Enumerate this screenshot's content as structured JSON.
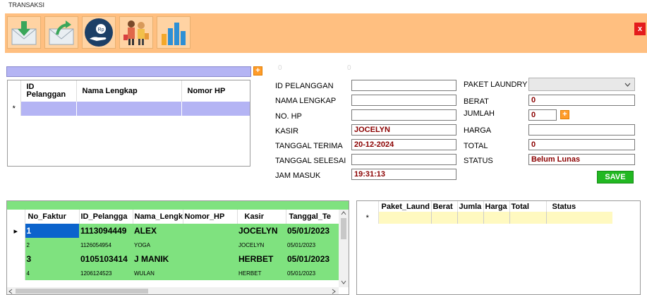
{
  "window": {
    "title": "TRANSAKSI"
  },
  "toolbar": {
    "buttons": [
      {
        "icon": "mail-inbox-icon"
      },
      {
        "icon": "mail-send-icon"
      },
      {
        "icon": "payment-hand-icon"
      },
      {
        "icon": "shopping-people-icon"
      },
      {
        "icon": "bar-chart-icon"
      }
    ],
    "close_label": "x"
  },
  "customer_search": {
    "value": "",
    "add_label": "+"
  },
  "customer_grid": {
    "columns": [
      "ID\nPelanggan",
      "Nama Lengkap",
      "Nomor HP"
    ],
    "new_row_marker": "*"
  },
  "ghost_labels": [
    "0",
    "0"
  ],
  "form": {
    "id_pelanggan": {
      "label": "ID PELANGGAN",
      "value": ""
    },
    "nama_lengkap": {
      "label": "NAMA LENGKAP",
      "value": ""
    },
    "no_hp": {
      "label": "NO. HP",
      "value": ""
    },
    "kasir": {
      "label": "KASIR",
      "value": "JOCELYN"
    },
    "tanggal_terima": {
      "label": "TANGGAL TERIMA",
      "value": "20-12-2024"
    },
    "tanggal_selesai": {
      "label": "TANGGAL SELESAI",
      "value": ""
    },
    "jam_masuk": {
      "label": "JAM MASUK",
      "value": "19:31:13"
    },
    "paket_laundry": {
      "label": "PAKET LAUNDRY",
      "value": ""
    },
    "berat": {
      "label": "BERAT",
      "value": "0"
    },
    "jumlah": {
      "label": "JUMLAH",
      "value": "0",
      "add_label": "+"
    },
    "harga": {
      "label": "HARGA",
      "value": ""
    },
    "total": {
      "label": "TOTAL",
      "value": "0"
    },
    "status": {
      "label": "STATUS",
      "value": "Belum Lunas"
    },
    "save_label": "SAVE"
  },
  "transactions": {
    "columns": [
      "No_Faktur",
      "ID_Pelanggan",
      "Nama_Lengkap",
      "Nomor_HP",
      "Kasir",
      "Tanggal_Te"
    ],
    "header_labels": [
      "No_Faktur",
      "ID_Pelangga",
      "Nama_Lengk",
      "Nomor_HP",
      "Kasir",
      "Tanggal_Te"
    ],
    "rows": [
      [
        "1",
        "1113094449",
        "ALEX",
        "",
        "JOCELYN",
        "05/01/2023"
      ],
      [
        "2",
        "1126054954",
        "YOGA",
        "",
        "JOCELYN",
        "05/01/2023"
      ],
      [
        "3",
        "0105103414",
        "J MANIK",
        "",
        "HERBET",
        "05/01/2023"
      ],
      [
        "4",
        "1206124523",
        "WULAN",
        "",
        "HERBET",
        "05/01/2023"
      ]
    ],
    "selected_marker": "▸"
  },
  "detail_grid": {
    "columns": [
      "Paket_Laund",
      "Berat",
      "Jumla",
      "Harga",
      "Total",
      "Status"
    ],
    "new_row_marker": "*"
  },
  "colors": {
    "toolbar_bg": "#ffbf80",
    "close_red": "#e41c1c",
    "search_blue": "#b4b4f4",
    "grid_green": "#7fe27f",
    "detail_yellow": "#fff9c0",
    "save_green": "#22b822",
    "field_text": "#8b0000"
  }
}
